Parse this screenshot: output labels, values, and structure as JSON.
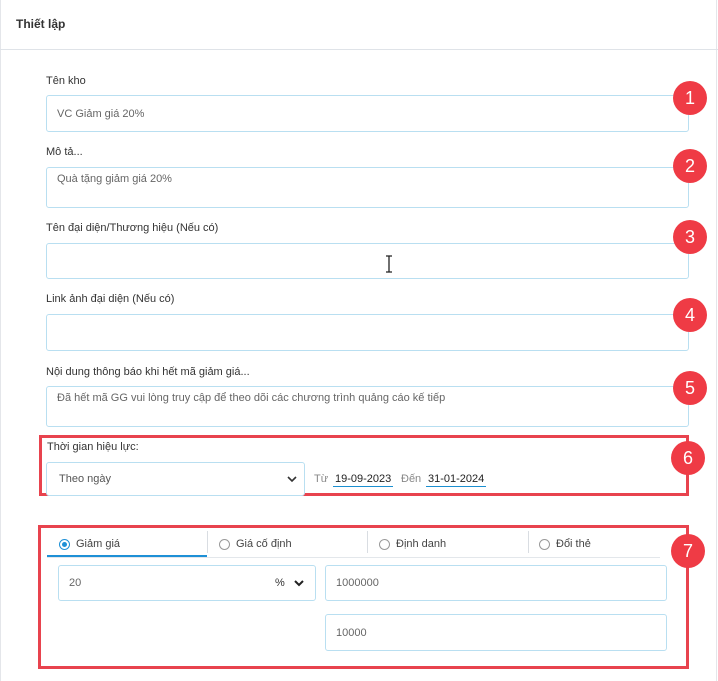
{
  "header": {
    "title": "Thiết lập"
  },
  "form": {
    "ten_kho": {
      "label": "Tên kho",
      "value": "VC Giảm giá 20%"
    },
    "mo_ta": {
      "label": "Mô tả...",
      "value": "Quà tặng giảm giá 20%"
    },
    "ten_dai_dien": {
      "label": "Tên đại diện/Thương hiệu (Nếu có)",
      "value": ""
    },
    "link_anh": {
      "label": "Link ảnh đại diện (Nếu có)",
      "value": ""
    },
    "noi_dung": {
      "label": "Nội dung thông báo khi hết mã giảm giá...",
      "value": "Đã hết mã GG vui lòng truy cập để theo dõi các chương trình quảng cáo kế tiếp"
    },
    "thoi_gian": {
      "label": "Thời gian hiệu lực:",
      "select_value": "Theo ngày",
      "from_label": "Từ",
      "from_date": "19-09-2023",
      "to_label": "Đến",
      "to_date": "31-01-2024"
    }
  },
  "discount": {
    "tabs": [
      {
        "label": "Giảm giá",
        "selected": true
      },
      {
        "label": "Giá cố định",
        "selected": false
      },
      {
        "label": "Định danh",
        "selected": false
      },
      {
        "label": "Đổi thẻ",
        "selected": false
      }
    ],
    "percent_value": "20",
    "unit": "%",
    "max_value": "1000000",
    "min_value": "10000"
  },
  "badges": [
    "1",
    "2",
    "3",
    "4",
    "5",
    "6",
    "7"
  ],
  "colors": {
    "accent": "#1e90d6",
    "badge": "#ef3b45",
    "highlight_border": "#e8434e",
    "input_border": "#b9dff1"
  },
  "icons": {
    "select": "chevron-down-icon",
    "cursor": "text-cursor-icon"
  }
}
